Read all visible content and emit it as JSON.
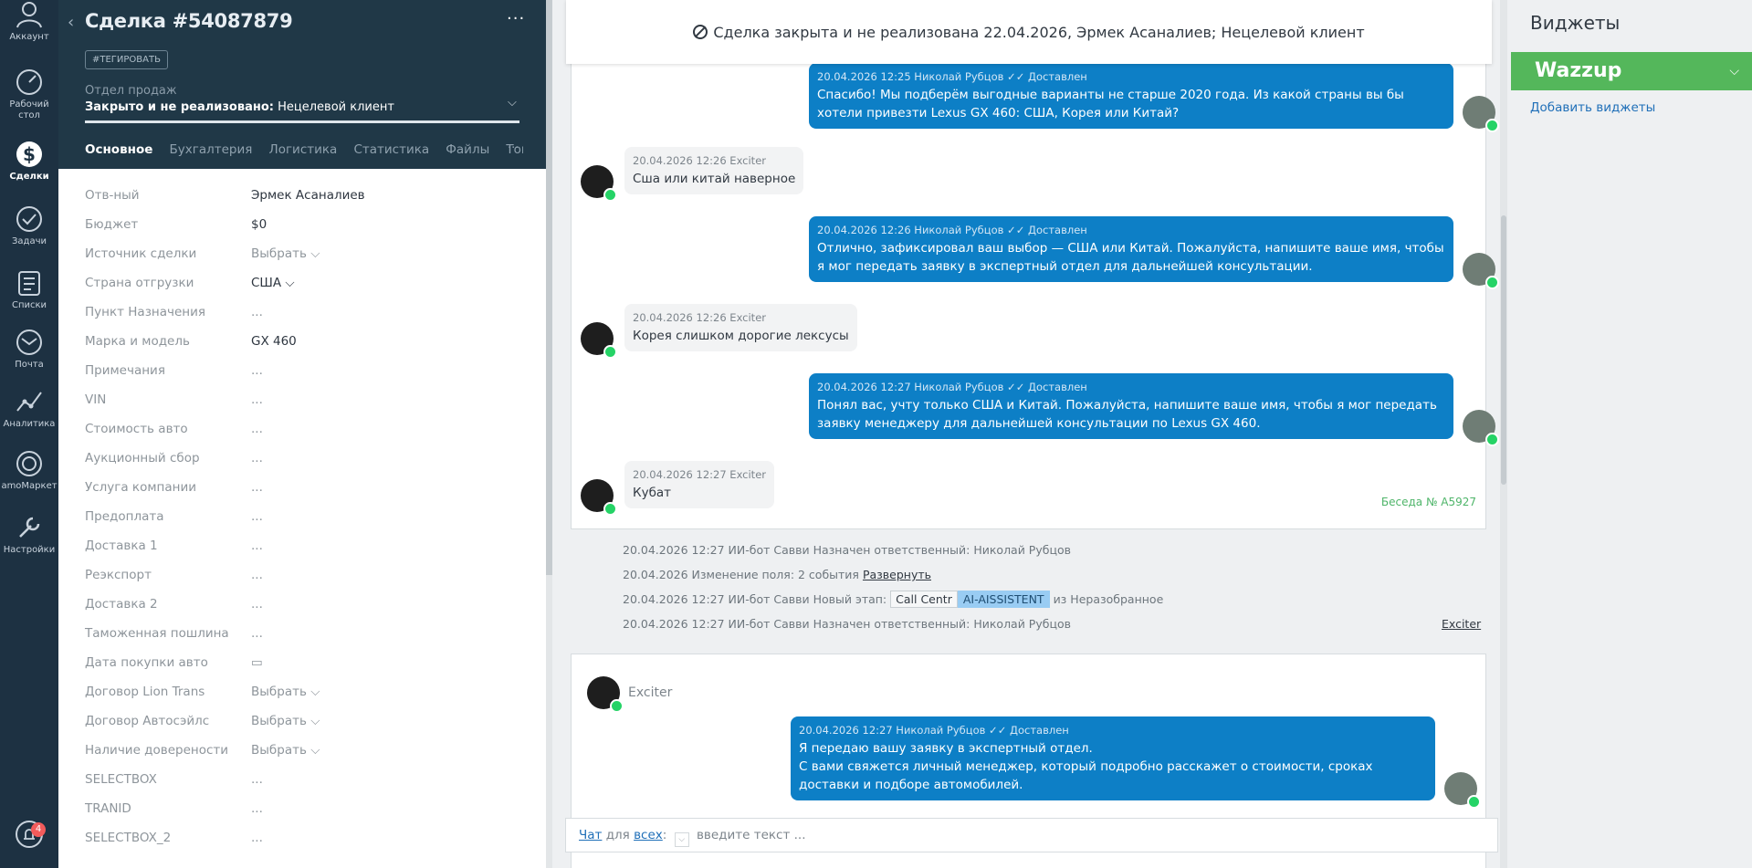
{
  "nav": {
    "items": [
      {
        "label": "Аккаунт",
        "icon": "account-icon"
      },
      {
        "label": "Рабочий стол",
        "icon": "dashboard-icon"
      },
      {
        "label": "Сделки",
        "icon": "deals-icon",
        "active": true
      },
      {
        "label": "Задачи",
        "icon": "tasks-icon"
      },
      {
        "label": "Списки",
        "icon": "lists-icon"
      },
      {
        "label": "Почта",
        "icon": "mail-icon"
      },
      {
        "label": "Аналитика",
        "icon": "analytics-icon"
      },
      {
        "label": "amoМаркет",
        "icon": "market-icon"
      },
      {
        "label": "Настройки",
        "icon": "settings-icon"
      }
    ],
    "notifications_count": "4"
  },
  "deal": {
    "title": "Сделка #54087879",
    "tag_label": "#ТЕГИРОВАТЬ",
    "pipeline": "Отдел продаж",
    "status_prefix": "Закрыто и не реализовано:",
    "status_reason": "Нецелевой клиент",
    "tabs": [
      "Основное",
      "Бухгалтерия",
      "Логистика",
      "Статистика",
      "Файлы",
      "Товары"
    ],
    "tabs_more": "···",
    "menu_label": "···"
  },
  "fields": [
    {
      "label": "Отв-ный",
      "value": "Эрмек Асаналиев"
    },
    {
      "label": "Бюджет",
      "value": "$0"
    },
    {
      "label": "Источник сделки",
      "value": "Выбрать ⌵"
    },
    {
      "label": "Страна отгрузки",
      "value": "США ⌵"
    },
    {
      "label": "Пункт Назначения",
      "value": "..."
    },
    {
      "label": "Марка и модель",
      "value": "GX 460"
    },
    {
      "label": "Примечания",
      "value": "..."
    },
    {
      "label": "VIN",
      "value": "..."
    },
    {
      "label": "Стоимость авто",
      "value": "..."
    },
    {
      "label": "Аукционный сбор",
      "value": "..."
    },
    {
      "label": "Услуга компании",
      "value": "..."
    },
    {
      "label": "Предоплата",
      "value": "..."
    },
    {
      "label": "Доставка 1",
      "value": "..."
    },
    {
      "label": "Реэкспорт",
      "value": "..."
    },
    {
      "label": "Доставка 2",
      "value": "..."
    },
    {
      "label": "Таможенная пошлина",
      "value": "..."
    },
    {
      "label": "Дата покупки авто",
      "value": "▭"
    },
    {
      "label": "Договор Lion Trans",
      "value": "Выбрать ⌵"
    },
    {
      "label": "Договор Автосэйлс",
      "value": "Выбрать ⌵"
    },
    {
      "label": "Наличие доверености",
      "value": "Выбрать ⌵"
    },
    {
      "label": "SELECTBOX",
      "value": "..."
    },
    {
      "label": "TRANID",
      "value": "..."
    },
    {
      "label": "SELECTBOX_2",
      "value": "..."
    }
  ],
  "notice": {
    "text": "Сделка закрыта и не реализована 22.04.2026, Эрмек Асаналиев; Нецелевой клиент"
  },
  "messages": [
    {
      "dir": "out",
      "meta": "20.04.2026 12:25 Николай Рубцов ✓✓ Доставлен",
      "text": "Спасибо! Мы подберём выгодные варианты не старше 2020 года. Из какой страны вы бы хотели привезти Lexus GX 460: США, Корея или Китай?"
    },
    {
      "dir": "in",
      "meta": "20.04.2026 12:26 Exciter",
      "text": "Сша или китай наверное"
    },
    {
      "dir": "out",
      "meta": "20.04.2026 12:26 Николай Рубцов ✓✓ Доставлен",
      "text": "Отлично, зафиксировал ваш выбор — США или Китай. Пожалуйста, напишите ваше имя, чтобы я мог передать заявку в экспертный отдел для дальнейшей консультации."
    },
    {
      "dir": "in",
      "meta": "20.04.2026 12:26 Exciter",
      "text": "Корея слишком дорогие лексусы"
    },
    {
      "dir": "out",
      "meta": "20.04.2026 12:27 Николай Рубцов ✓✓ Доставлен",
      "text": "Понял вас, учту только США и Китай. Пожалуйста, напишите ваше имя, чтобы я мог передать заявку менеджеру для дальнейшей консультации по Lexus GX 460."
    },
    {
      "dir": "in",
      "meta": "20.04.2026 12:27 Exciter",
      "text": "Кубат"
    }
  ],
  "conversation_number": "Беседа № A5927",
  "events": {
    "e1": "20.04.2026 12:27 ИИ-бот Савви Назначен ответственный: Николай Рубцов",
    "e2_prefix": "20.04.2026 Изменение поля: 2 события",
    "e2_link": "Развернуть",
    "e3_prefix": "20.04.2026 12:27 ИИ-бот Савви Новый этап:",
    "e3_stage_from": "Call Centr",
    "e3_stage_to": "AI-AISSISTENT",
    "e3_suffix": "из Неразобранное",
    "e4": "20.04.2026 12:27 ИИ-бот Савви Назначен ответственный: Николай Рубцов",
    "e4_link": "Exciter"
  },
  "conv2": {
    "contact": "Exciter",
    "meta": "20.04.2026 12:27 Николай Рубцов ✓✓ Доставлен",
    "line1": "Я передаю вашу заявку в экспертный отдел.",
    "line2": "С вами свяжется личный менеджер, который подробно расскажет о стоимости, сроках доставки и подборе автомобилей."
  },
  "composer": {
    "chat_link": "Чат",
    "for_label": "для",
    "all_link": "всех",
    "colon": ":",
    "placeholder": "введите текст ..."
  },
  "widgets": {
    "title": "Виджеты",
    "wazzup": "Wazzup",
    "add_link": "Добавить виджеты"
  },
  "colors": {
    "nav_bg": "#1d3142",
    "header_bg": "#203847",
    "bubble_out": "#0d7fc6",
    "wazzup_green": "#54b75b",
    "link": "#1f6fb8"
  }
}
